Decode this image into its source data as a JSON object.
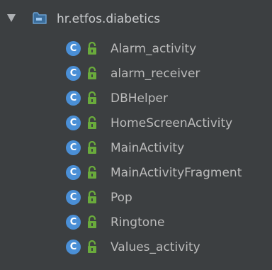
{
  "package": {
    "name": "hr.etfos.diabetics",
    "expanded": true,
    "icon": "package-folder-icon"
  },
  "classes": [
    {
      "name": "Alarm_activity"
    },
    {
      "name": "alarm_receiver"
    },
    {
      "name": "DBHelper"
    },
    {
      "name": "HomeScreenActivity"
    },
    {
      "name": "MainActivity"
    },
    {
      "name": "MainActivityFragment"
    },
    {
      "name": "Pop"
    },
    {
      "name": "Ringtone"
    },
    {
      "name": "Values_activity"
    }
  ],
  "icons": {
    "class_badge": "C",
    "class_icon": "class-icon",
    "access_icon": "public-lock-icon"
  },
  "colors": {
    "background": "#3c3f41",
    "class_icon": "#4a8fd6",
    "lock": "#6aab3c",
    "folder": "#4a8fd6",
    "text": "#bbbbbb"
  }
}
